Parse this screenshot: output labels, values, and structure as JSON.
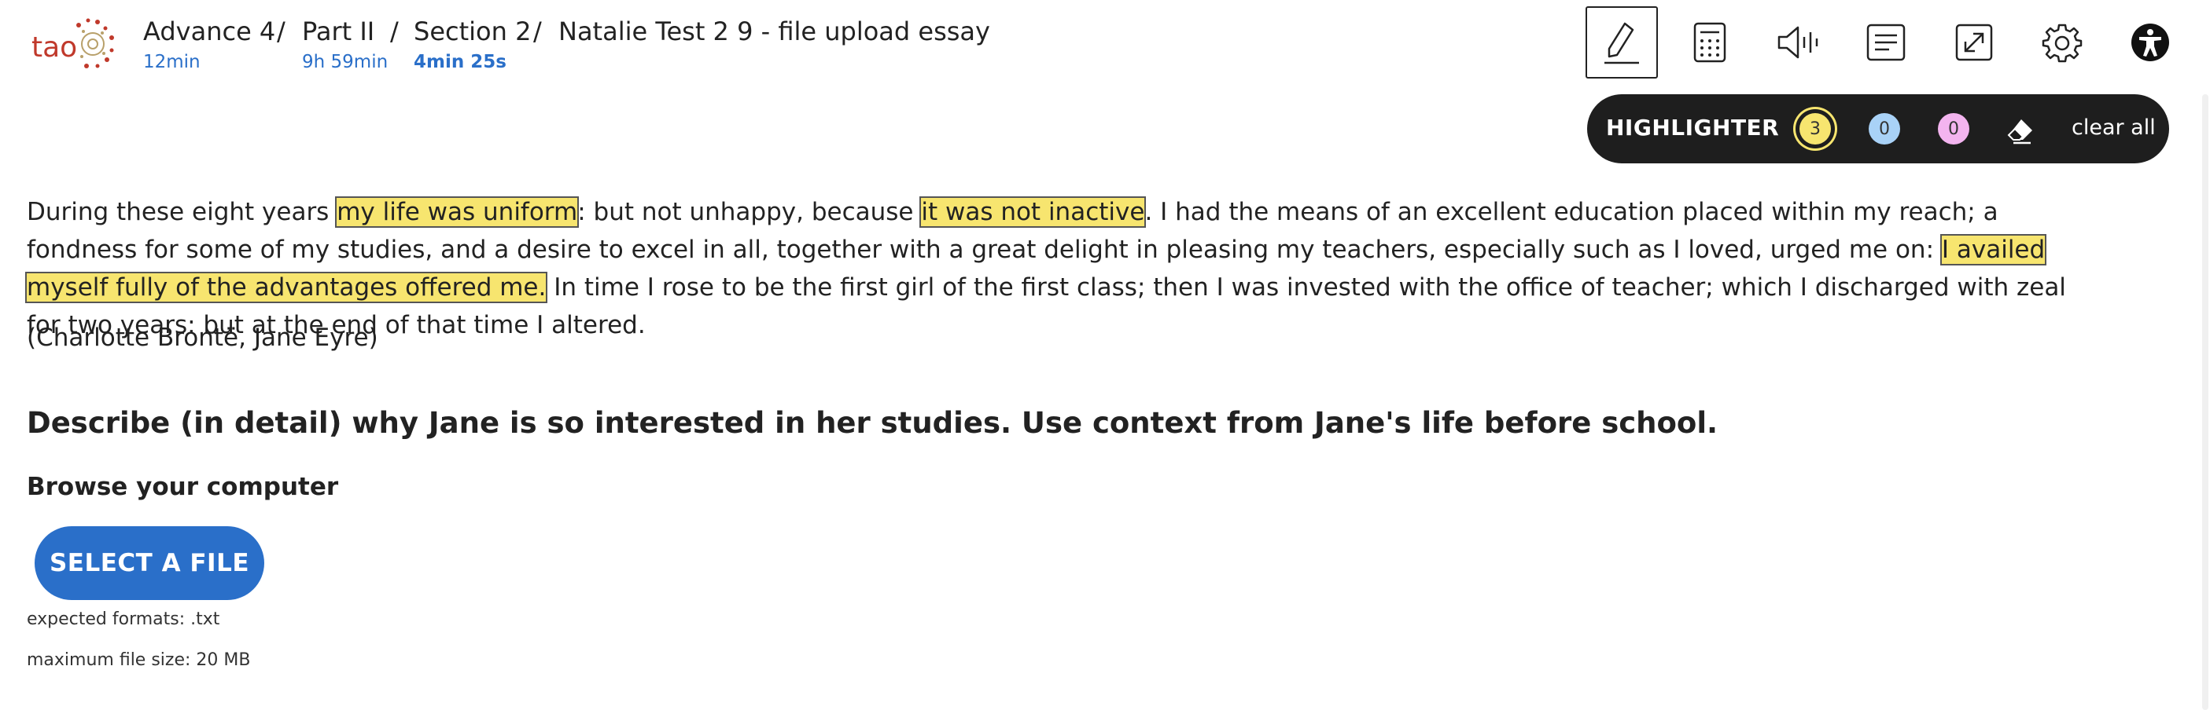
{
  "header": {
    "logo_text": "tao",
    "breadcrumbs": [
      {
        "title": "Advance 4",
        "sub": "12min"
      },
      {
        "title": "Part II",
        "sub": "9h 59min"
      },
      {
        "title": "Section 2",
        "sub": "4min 25s"
      },
      {
        "title": "Natalie Test 2 9 - file upload essay",
        "sub": ""
      }
    ],
    "separator": "/"
  },
  "toolbar": {
    "tools": [
      "highlighter-pen-icon",
      "calculator-icon",
      "text-to-speech-icon",
      "line-reader-icon",
      "fullscreen-icon",
      "settings-gear-icon",
      "accessibility-icon"
    ]
  },
  "highlighter": {
    "title": "HIGHLIGHTER",
    "yellow_count": "3",
    "blue_count": "0",
    "pink_count": "0",
    "clear_label": "clear all",
    "colors": {
      "yellow": "#f7e56f",
      "blue": "#a9d2f7",
      "pink": "#f3b4ef"
    }
  },
  "passage": {
    "p1": "During these eight years ",
    "h1": "my life was uniform",
    "p2": ": but not unhappy, because ",
    "h2": "it was not inactive",
    "p3": ". I had the means of an excellent education placed within my reach; a fondness for some of my studies, and a desire to excel in all, together with a great delight in pleasing my teachers, especially such as I loved, urged me on: ",
    "h3": "I availed myself fully of the advantages offered me.",
    "p4": " In time I rose to be the first girl of the first class; then I was invested with the office of teacher; which I discharged with zeal for two years: but at the end of that time I altered.",
    "citation": "(Charlotte Brontë, Jane Eyre)"
  },
  "question": "Describe (in detail) why Jane is so interested in her studies. Use context from Jane's life before school.",
  "upload": {
    "browse_label": "Browse your computer",
    "button_label": "SELECT A FILE",
    "formats": "expected formats: .txt",
    "max_size": "maximum file size: 20 MB"
  }
}
